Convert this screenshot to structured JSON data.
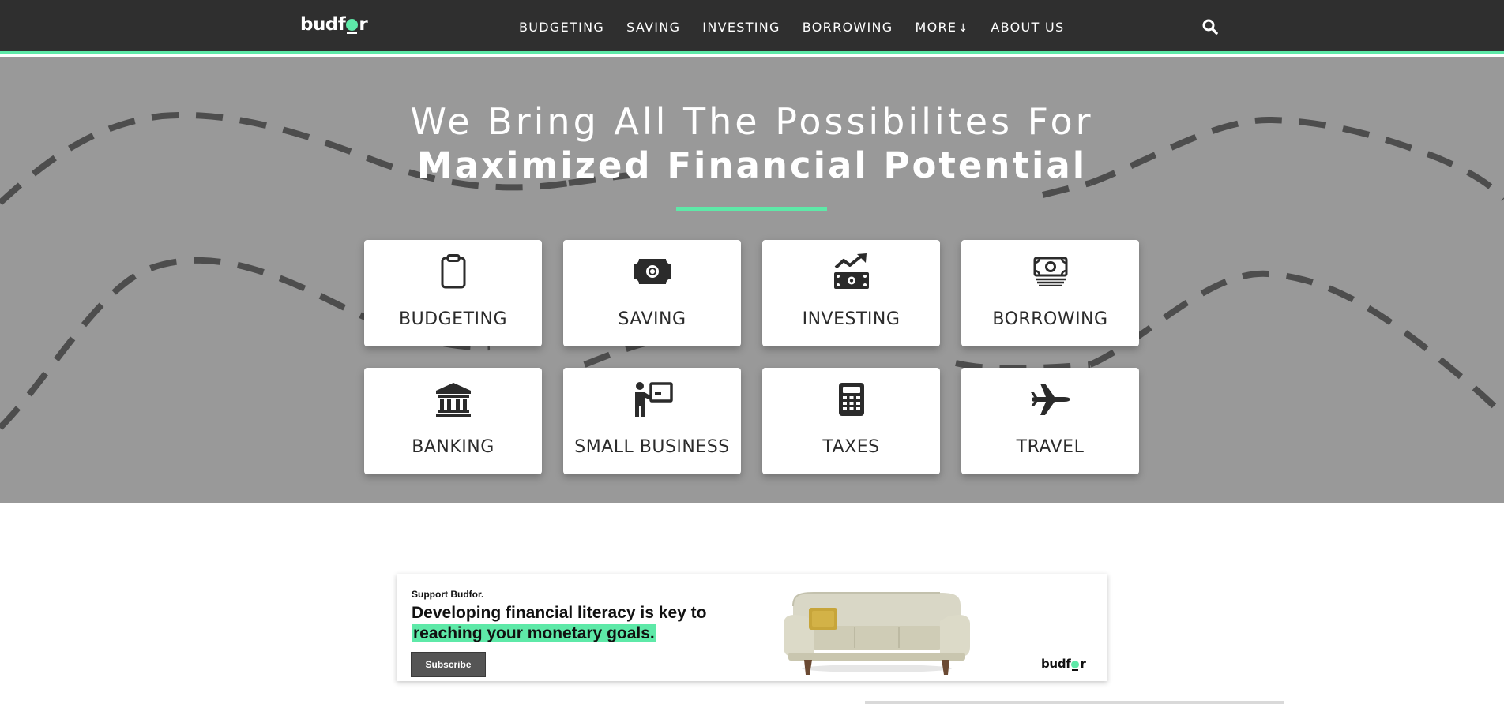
{
  "nav": {
    "logo_prefix": "budf",
    "logo_suffix": "r",
    "links": [
      {
        "label": "BUDGETING"
      },
      {
        "label": "SAVING"
      },
      {
        "label": "INVESTING"
      },
      {
        "label": "BORROWING"
      },
      {
        "label": "MORE",
        "arrow": "↓"
      },
      {
        "label": "ABOUT US"
      }
    ],
    "search_icon": "magnifier-icon"
  },
  "hero": {
    "line1": "We Bring All The Possibilites For",
    "line2": "Maximized Financial Potential",
    "accent_color": "#5ee9a8",
    "background_color": "#999999",
    "cards": [
      {
        "label": "BUDGETING",
        "icon": "clipboard-icon"
      },
      {
        "label": "SAVING",
        "icon": "cash-bill-icon"
      },
      {
        "label": "INVESTING",
        "icon": "money-growth-icon"
      },
      {
        "label": "BORROWING",
        "icon": "money-stack-icon"
      },
      {
        "label": "BANKING",
        "icon": "bank-building-icon"
      },
      {
        "label": "SMALL BUSINESS",
        "icon": "presenter-board-icon"
      },
      {
        "label": "TAXES",
        "icon": "calculator-icon"
      },
      {
        "label": "TRAVEL",
        "icon": "airplane-icon"
      }
    ]
  },
  "ad": {
    "kicker": "Support Budfor.",
    "headline_plain": "Developing financial literacy is key to ",
    "headline_highlight": "reaching your monetary goals.",
    "button_label": "Subscribe",
    "logo_prefix": "budf",
    "logo_suffix": "r"
  }
}
